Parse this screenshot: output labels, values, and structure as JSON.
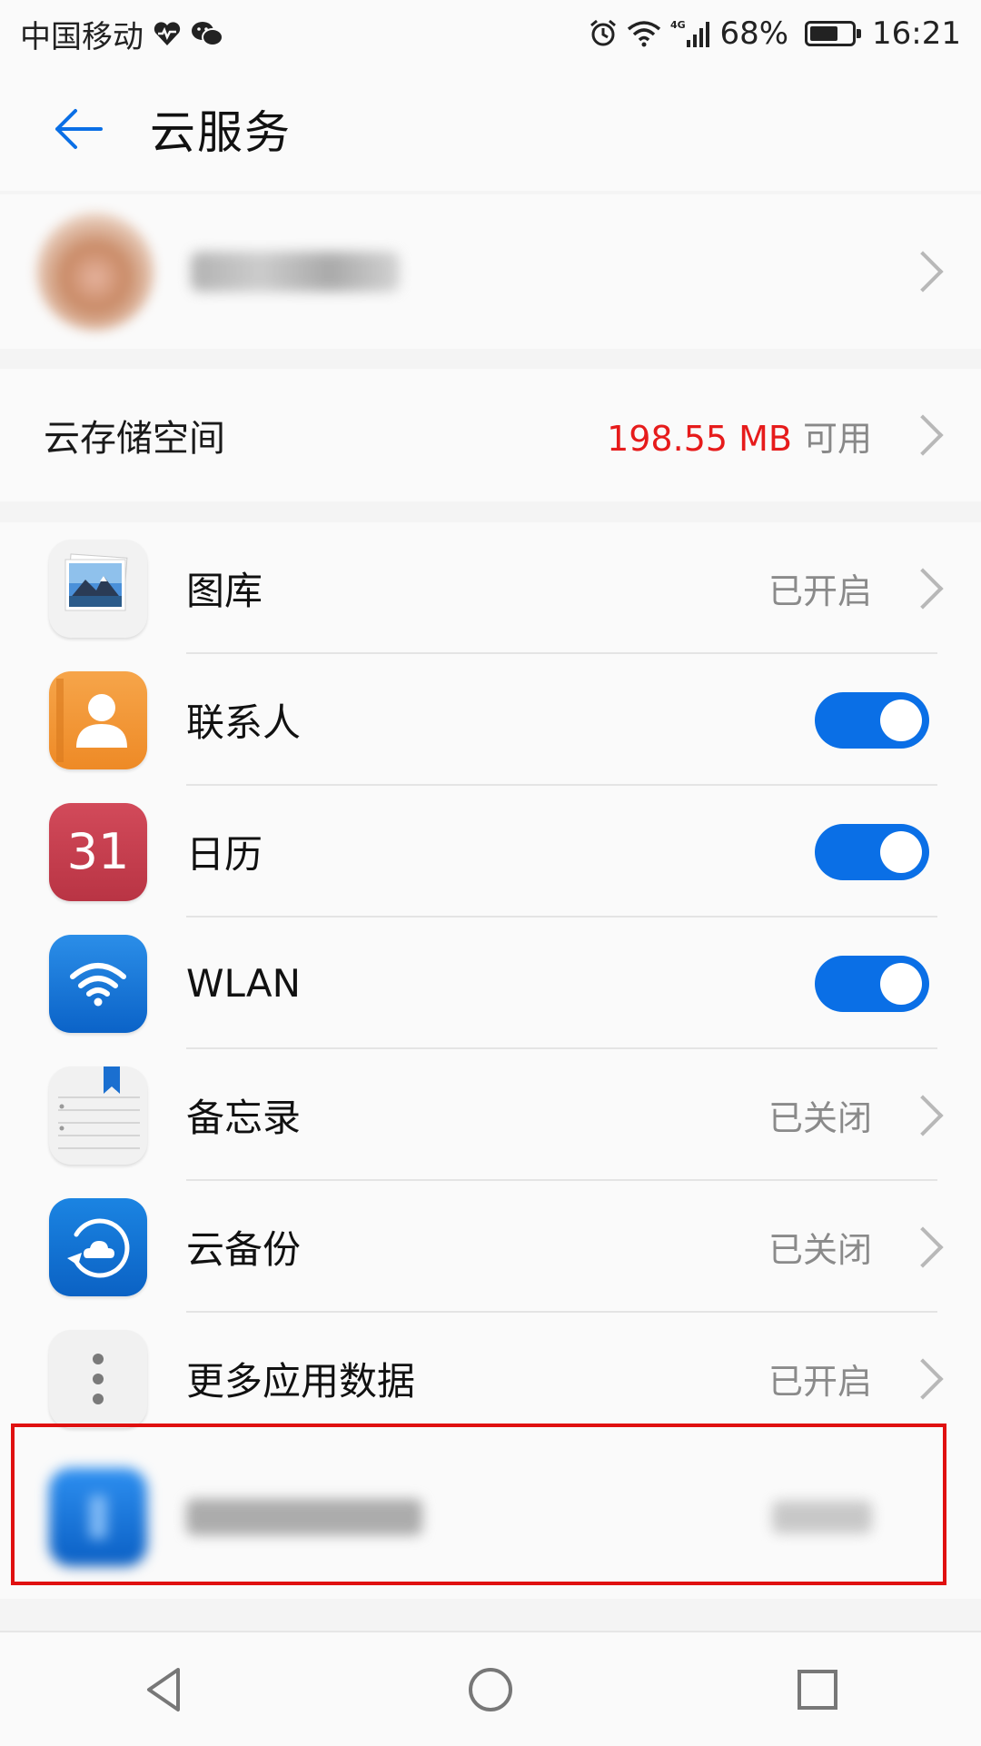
{
  "status_bar": {
    "carrier": "中国移动",
    "network": "4G",
    "battery": "68%",
    "battery_level": 0.68,
    "time": "16:21"
  },
  "header": {
    "title": "云服务"
  },
  "storage": {
    "label": "云存储空间",
    "amount": "198.55 MB",
    "suffix": "可用"
  },
  "items": [
    {
      "label": "图库",
      "status": "已开启",
      "control": "chevron",
      "icon": "gallery-icon"
    },
    {
      "label": "联系人",
      "control": "toggle",
      "on": true,
      "icon": "contacts-icon"
    },
    {
      "label": "日历",
      "control": "toggle",
      "on": true,
      "icon": "calendar-icon",
      "icon_text": "31"
    },
    {
      "label": "WLAN",
      "control": "toggle",
      "on": true,
      "icon": "wifi-icon"
    },
    {
      "label": "备忘录",
      "status": "已关闭",
      "control": "chevron",
      "icon": "notes-icon"
    },
    {
      "label": "云备份",
      "status": "已关闭",
      "control": "chevron",
      "icon": "cloud-backup-icon"
    },
    {
      "label": "更多应用数据",
      "status": "已开启",
      "control": "chevron",
      "icon": "more-icon"
    }
  ],
  "colors": {
    "accent": "#0a6fe6",
    "storage_red": "#e61b1b",
    "highlight_red": "#e01010"
  }
}
